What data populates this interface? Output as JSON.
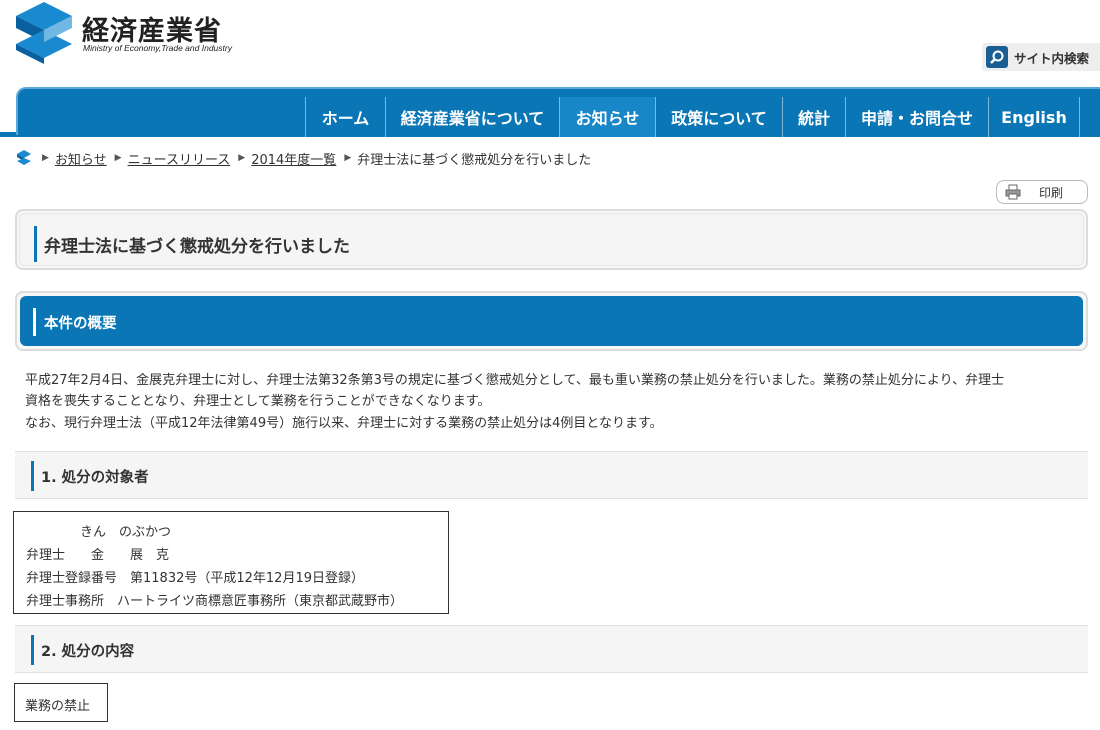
{
  "header": {
    "logo_title": "経済産業省",
    "logo_subtitle": "Ministry of Economy,Trade and Industry",
    "site_search_label": "サイト内検索"
  },
  "nav": {
    "items": [
      {
        "label": "ホーム"
      },
      {
        "label": "経済産業省について"
      },
      {
        "label": "お知らせ"
      },
      {
        "label": "政策について"
      },
      {
        "label": "統計"
      },
      {
        "label": "申請・お問合せ"
      },
      {
        "label": "English"
      }
    ]
  },
  "breadcrumb": {
    "items": [
      "お知らせ",
      "ニュースリリース",
      "2014年度一覧"
    ],
    "current": "弁理士法に基づく懲戒処分を行いました"
  },
  "print_label": "印刷",
  "page_title": "弁理士法に基づく懲戒処分を行いました",
  "summary": {
    "heading": "本件の概要",
    "line1": "平成27年2月4日、金展克弁理士に対し、弁理士法第32条第3号の規定に基づく懲戒処分として、最も重い業務の禁止処分を行いました。業務の禁止処分により、弁理士",
    "line2": "資格を喪失することとなり、弁理士として業務を行うことができなくなります。",
    "line3": "なお、現行弁理士法（平成12年法律第49号）施行以来、弁理士に対する業務の禁止処分は4例目となります。"
  },
  "section1": {
    "heading": "1.  処分の対象者",
    "furigana": "きん　のぶかつ",
    "name_line": "弁理士　　金　　展　克",
    "registration_line": "弁理士登録番号　第11832号（平成12年12月19日登録）",
    "office_line": "弁理士事務所　ハートライツ商標意匠事務所（東京都武蔵野市）"
  },
  "section2": {
    "heading": "2.  処分の内容",
    "content": "業務の禁止"
  },
  "colors": {
    "brand_blue": "#0a76b5",
    "active_nav": "#1887c7"
  }
}
